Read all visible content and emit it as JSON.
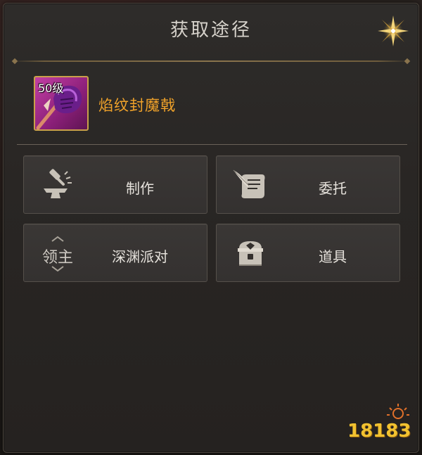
{
  "dialog": {
    "title": "获取途径",
    "close_icon": "sparkle-star-close-icon"
  },
  "item": {
    "level": "50级",
    "name": "焰纹封魔戟",
    "name_color": "#f0a22a",
    "icon": "purple-fist-weapon-icon",
    "frame_color": "#c9a04a"
  },
  "sources": [
    {
      "id": "make",
      "label": "制作",
      "icon": "anvil-hammer-icon"
    },
    {
      "id": "quest",
      "label": "委托",
      "icon": "scroll-quill-icon"
    },
    {
      "id": "abyss",
      "label": "深渊派对",
      "icon": "boss-lord-icon",
      "icon_text": "领主"
    },
    {
      "id": "item",
      "label": "道具",
      "icon": "treasure-chest-icon"
    }
  ],
  "watermark": {
    "text": "18183",
    "icon": "sun-logo-icon"
  }
}
